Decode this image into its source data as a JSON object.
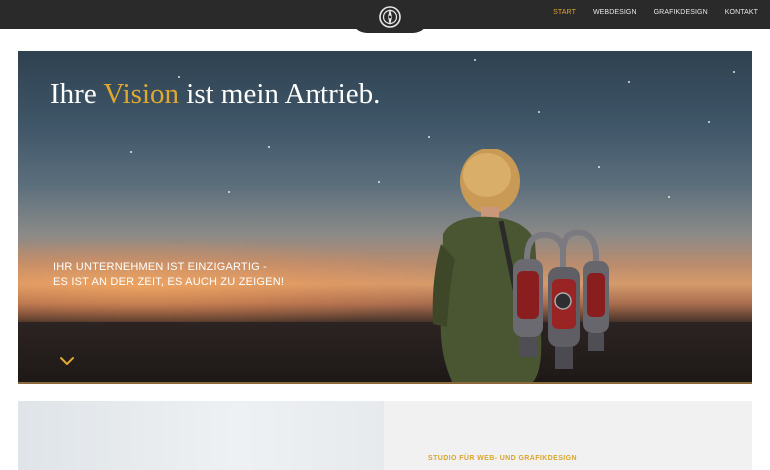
{
  "nav": {
    "logo_icon": "compass-logo-icon",
    "items": [
      {
        "label": "START",
        "active": true
      },
      {
        "label": "WEBDESIGN",
        "active": false
      },
      {
        "label": "GRAFIKDESIGN",
        "active": false
      },
      {
        "label": "KONTAKT",
        "active": false
      }
    ]
  },
  "hero": {
    "headline_before": "Ihre ",
    "headline_accent": "Vision",
    "headline_after": " ist mein Antrieb.",
    "subline_1": "IHR UNTERNEHMEN IST EINZIGARTIG -",
    "subline_2": "ES IST AN DER ZEIT, ES AUCH ZU ZEIGEN!",
    "scroll_icon": "chevron-down-icon"
  },
  "section": {
    "studio_label": "STUDIO FÜR WEB- UND GRAFIKDESIGN"
  },
  "colors": {
    "accent": "#d9a52e",
    "topbar": "#2a2a2a",
    "text_light": "#ffffff"
  }
}
